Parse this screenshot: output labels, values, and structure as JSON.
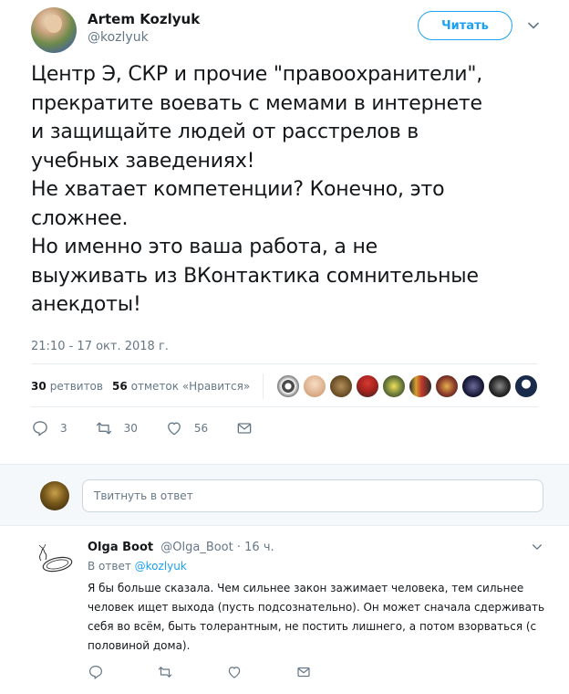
{
  "tweet": {
    "author_name": "Artem Kozlyuk",
    "author_handle": "@kozlyuk",
    "follow_label": "Читать",
    "text_lines": [
      "Центр Э, СКР и прочие \"правоохранители\",",
      "прекратите воевать с мемами в интернете",
      "и защищайте людей от расстрелов в",
      "учебных заведениях!",
      "Не хватает компетенции? Конечно, это",
      "сложнее.",
      "Но именно это ваша работа, а не",
      "выуживать из ВКонтактика сомнительные",
      "анекдоты!"
    ],
    "timestamp": "21:10 - 17 окт. 2018 г.",
    "stats": {
      "retweets_count": "30",
      "retweets_label": "ретвитов",
      "likes_count": "56",
      "likes_label": "отметок «Нравится»"
    },
    "liker_avatar_colors": [
      "#5a5a5a",
      "#e9c7a8",
      "#8a6a3a",
      "#b8262a",
      "#d8c23a",
      "#3a3a3a",
      "#c49a3a",
      "#1a1a3a",
      "#2a2a2a",
      "#1a2a4a"
    ],
    "actions": {
      "reply_count": "3",
      "retweet_count": "30",
      "like_count": "56"
    }
  },
  "composer": {
    "placeholder": "Твитнуть в ответ"
  },
  "reply": {
    "author_name": "Olga Boot",
    "author_handle": "@Olga_Boot",
    "time": "· 16 ч.",
    "context_prefix": "В ответ",
    "context_handle": "@kozlyuk",
    "text_lines": [
      "Я бы больше сказала. Чем сильнее закон зажимает человека, тем сильнее",
      "человек ищет выхода (пусть подсознательно). Он может сначала сдерживать",
      "себя во всём, быть толерантным, не постить лишнего, а потом взорваться (с",
      "половиной дома)."
    ]
  },
  "colors": {
    "accent": "#1da1f2",
    "muted": "#657786",
    "text": "#14171a",
    "border": "#e6ecf0"
  }
}
